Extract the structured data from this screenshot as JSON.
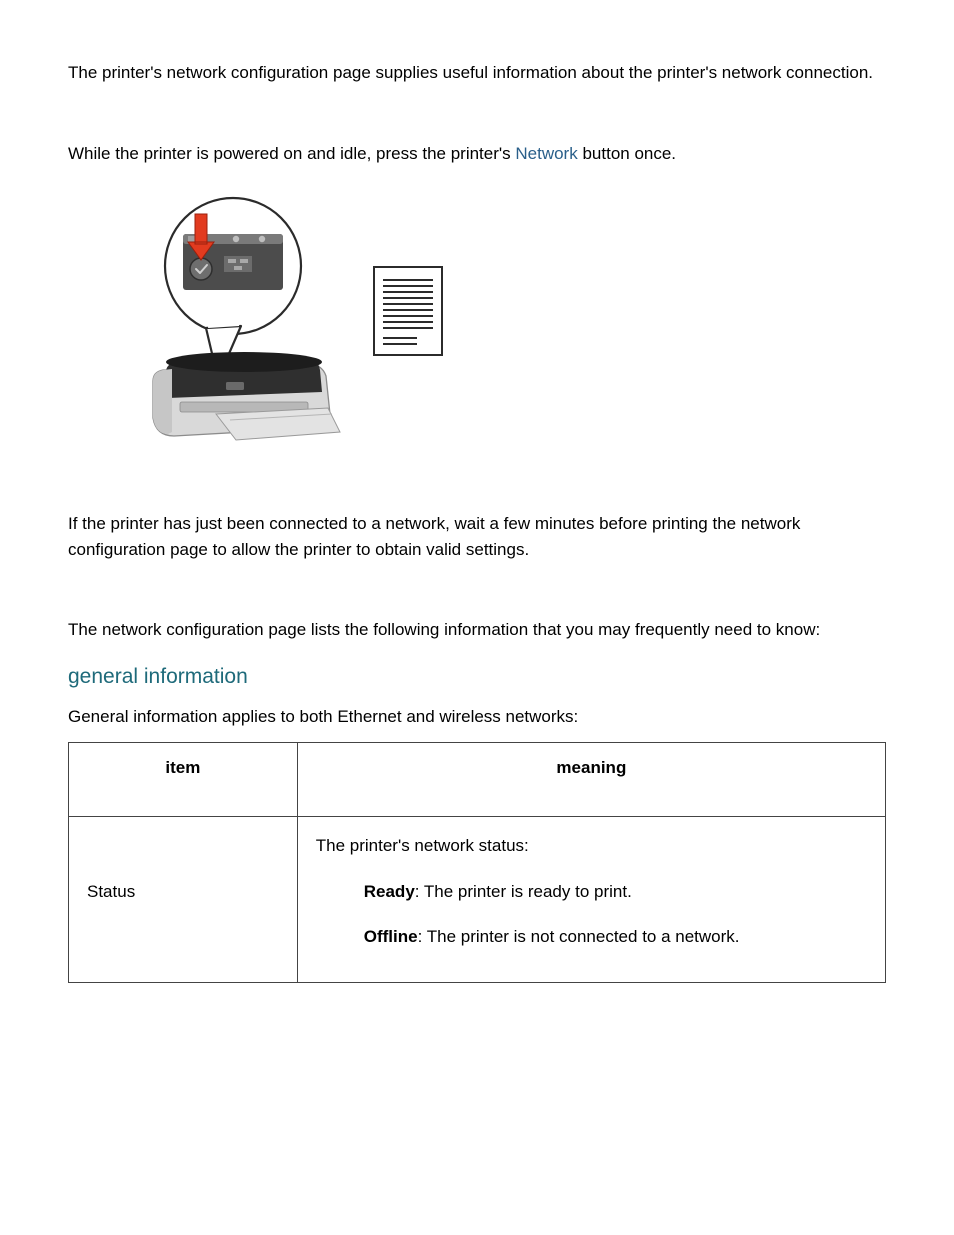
{
  "intro": "The printer's network configuration page supplies useful information about the printer's network connection.",
  "instruction_pre": "While the printer is powered on and idle, press the printer's ",
  "instruction_link": "Network",
  "instruction_post": " button once.",
  "wait_note": "If the printer has just been connected to a network, wait a few minutes before printing the network configuration page to allow the printer to obtain valid settings.",
  "list_intro": "The network configuration page lists the following information that you may frequently need to know:",
  "general_heading": "general information",
  "general_desc": "General information applies to both Ethernet and wireless networks:",
  "table": {
    "headers": {
      "item": "item",
      "meaning": "meaning"
    },
    "rows": [
      {
        "item": "Status",
        "meaning_intro": "The printer's network status:",
        "details": [
          {
            "term": "Ready",
            "desc": ": The printer is ready to print."
          },
          {
            "term": "Offline",
            "desc": ": The printer is not connected to a network."
          }
        ]
      }
    ]
  }
}
